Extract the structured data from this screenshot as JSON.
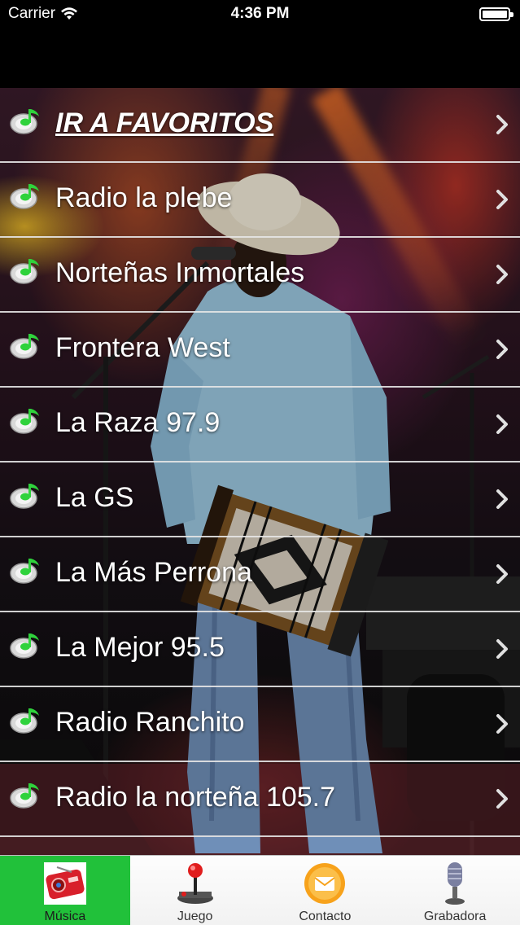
{
  "status_bar": {
    "carrier": "Carrier",
    "time": "4:36 PM",
    "wifi_icon": "wifi-icon",
    "battery_icon": "battery-icon"
  },
  "stations": [
    {
      "label": "IR A FAVORITOS",
      "favorite": true
    },
    {
      "label": "Radio la plebe"
    },
    {
      "label": "Norteñas Inmortales"
    },
    {
      "label": "Frontera West"
    },
    {
      "label": "La Raza 97.9"
    },
    {
      "label": "La GS"
    },
    {
      "label": "La Más Perrona"
    },
    {
      "label": "La Mejor 95.5"
    },
    {
      "label": "Radio Ranchito"
    },
    {
      "label": "Radio la norteña 105.7"
    }
  ],
  "row_icon": "music-note-icon",
  "row_chevron": "chevron-right-icon",
  "tab_bar": {
    "tabs": [
      {
        "label": "Música",
        "icon": "radio-icon",
        "active": true
      },
      {
        "label": "Juego",
        "icon": "joystick-icon",
        "active": false
      },
      {
        "label": "Contacto",
        "icon": "mail-icon",
        "active": false
      },
      {
        "label": "Grabadora",
        "icon": "microphone-icon",
        "active": false
      }
    ]
  },
  "colors": {
    "active_tab": "#21c13a",
    "row_divider": "#e6e6e6",
    "note_green": "#2fd23c"
  }
}
